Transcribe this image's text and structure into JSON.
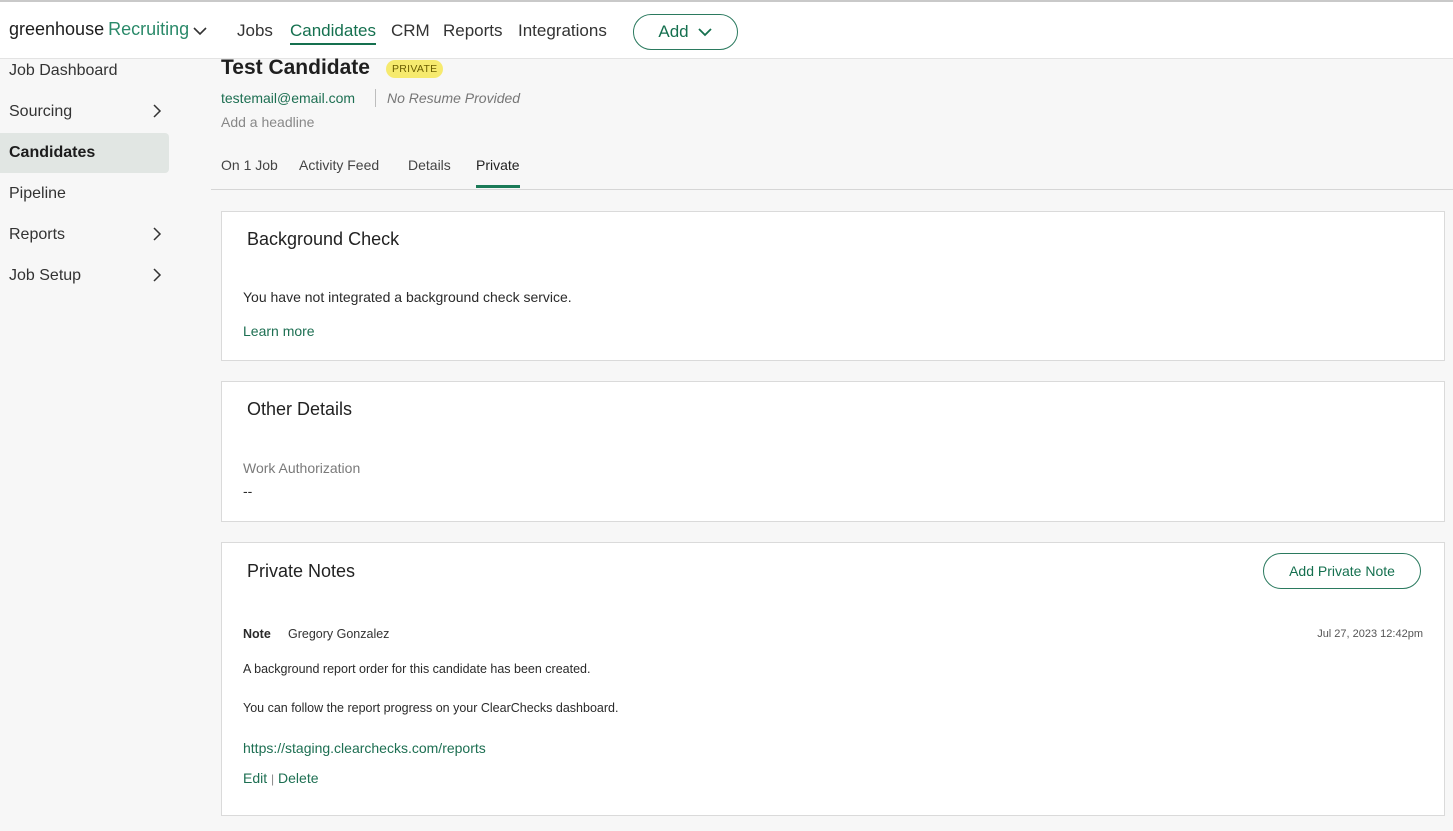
{
  "topnav": {
    "brand_primary": "greenhouse",
    "brand_secondary": "Recruiting",
    "links": [
      "Jobs",
      "Candidates",
      "CRM",
      "Reports",
      "Integrations"
    ],
    "active_link": "Candidates",
    "add_label": "Add"
  },
  "sidebar": {
    "items": [
      {
        "label": "Job Dashboard",
        "has_chevron": false
      },
      {
        "label": "Sourcing",
        "has_chevron": true
      },
      {
        "label": "Candidates",
        "has_chevron": false,
        "active": true
      },
      {
        "label": "Pipeline",
        "has_chevron": false
      },
      {
        "label": "Reports",
        "has_chevron": true
      },
      {
        "label": "Job Setup",
        "has_chevron": true
      }
    ]
  },
  "candidate": {
    "name": "Test Candidate",
    "badge": "PRIVATE",
    "email": "testemail@email.com",
    "resume_status": "No Resume Provided",
    "headline_placeholder": "Add a headline"
  },
  "tabs": [
    "On 1 Job",
    "Activity Feed",
    "Details",
    "Private"
  ],
  "active_tab": "Private",
  "background_check": {
    "title": "Background Check",
    "message": "You have not integrated a background check service.",
    "link_label": "Learn more"
  },
  "other_details": {
    "title": "Other Details",
    "field_label": "Work Authorization",
    "field_value": "--"
  },
  "private_notes": {
    "title": "Private Notes",
    "add_button": "Add Private Note",
    "note": {
      "type_label": "Note",
      "author": "Gregory Gonzalez",
      "timestamp": "Jul 27, 2023 12:42pm",
      "line1": "A background report order for this candidate has been created.",
      "line2": "You can follow the report progress on your ClearChecks dashboard.",
      "url": "https://staging.clearchecks.com/reports",
      "edit_label": "Edit",
      "separator": "|",
      "delete_label": "Delete"
    }
  },
  "colors": {
    "accent_green": "#15704f",
    "badge_yellow": "#f6ea6e",
    "sidebar_active_bg": "#e1e6e3"
  }
}
